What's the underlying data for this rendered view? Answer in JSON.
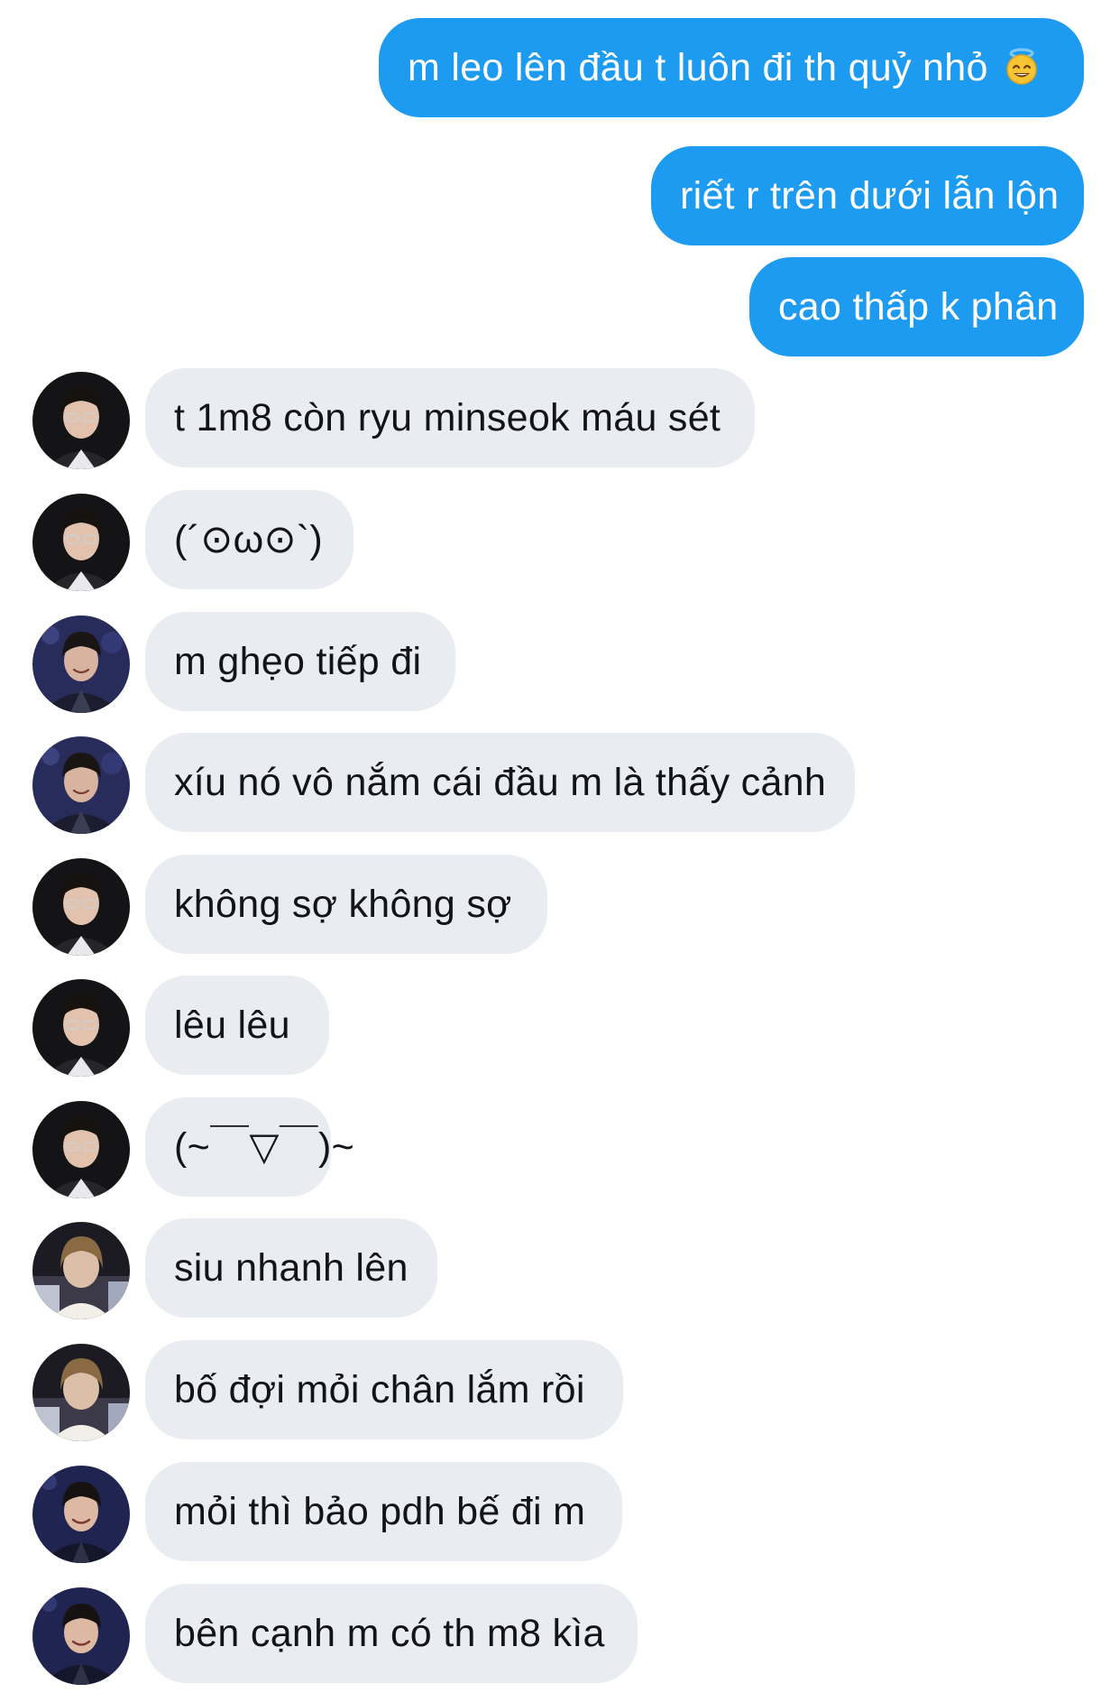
{
  "colors": {
    "outgoing_bubble": "#1d9bf0",
    "incoming_bubble": "#e9ecf0",
    "incoming_text": "#111418",
    "outgoing_text": "#ffffff"
  },
  "messages": [
    {
      "direction": "outgoing",
      "text": "m leo lên đầu t luôn đi th quỷ nhỏ",
      "emoji": "smiling-face-with-halo"
    },
    {
      "direction": "outgoing",
      "text": "riết r trên dưới lẫn lộn"
    },
    {
      "direction": "outgoing",
      "text": "cao thấp k phân"
    },
    {
      "direction": "incoming",
      "avatar": "avatar-glasses-dark",
      "text": "t 1m8 còn ryu minseok máu sét"
    },
    {
      "direction": "incoming",
      "avatar": "avatar-glasses-dark",
      "text": "(´⊙ω⊙`)"
    },
    {
      "direction": "incoming",
      "avatar": "avatar-smiling-blue",
      "text": "m ghẹo tiếp đi"
    },
    {
      "direction": "incoming",
      "avatar": "avatar-smiling-blue",
      "text": "xíu nó vô nắm cái đầu m là thấy cảnh"
    },
    {
      "direction": "incoming",
      "avatar": "avatar-glasses-dark",
      "text": "không sợ không sợ"
    },
    {
      "direction": "incoming",
      "avatar": "avatar-glasses-dark",
      "text": "lêu lêu"
    },
    {
      "direction": "incoming",
      "avatar": "avatar-glasses-dark",
      "text": "(~￣▽￣)~"
    },
    {
      "direction": "incoming",
      "avatar": "avatar-stage-light",
      "text": "siu nhanh lên"
    },
    {
      "direction": "incoming",
      "avatar": "avatar-stage-light",
      "text": "bố đợi mỏi chân lắm rồi"
    },
    {
      "direction": "incoming",
      "avatar": "avatar-smiling-navy",
      "text": "mỏi thì bảo pdh bế đi m"
    },
    {
      "direction": "incoming",
      "avatar": "avatar-smiling-navy",
      "text": "bên cạnh m có th m8 kìa"
    }
  ]
}
